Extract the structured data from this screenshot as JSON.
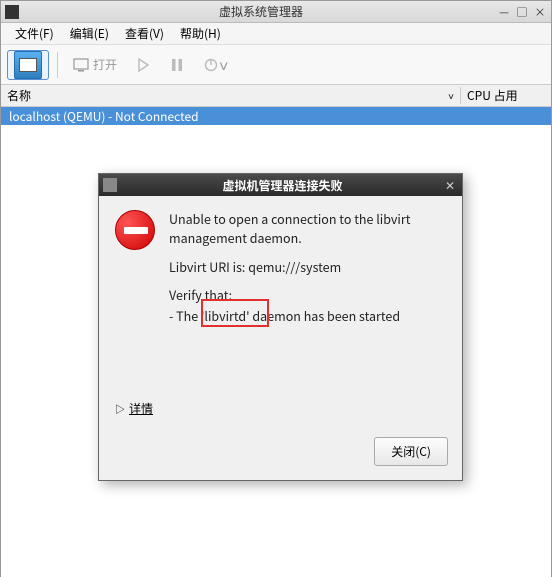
{
  "window": {
    "title": "虚拟系统管理器",
    "controls": {
      "min": "—",
      "max": "□",
      "close": "×"
    }
  },
  "menubar": {
    "file": "文件(F)",
    "edit": "编辑(E)",
    "view": "查看(V)",
    "help": "帮助(H)"
  },
  "toolbar": {
    "open_label": "打开"
  },
  "columns": {
    "name": "名称",
    "cpu": "CPU 占用",
    "sort": "˅"
  },
  "list": {
    "row0": "localhost (QEMU) - Not Connected"
  },
  "dialog": {
    "title": "虚拟机管理器连接失败",
    "msg1": "Unable to open a connection to the libvirt management daemon.",
    "msg2": "Libvirt URI is: qemu:///system",
    "msg3": "Verify that:",
    "msg4": " - The 'libvirtd' daemon has been started",
    "details_label": "详情",
    "close_label": "关闭(C)"
  }
}
